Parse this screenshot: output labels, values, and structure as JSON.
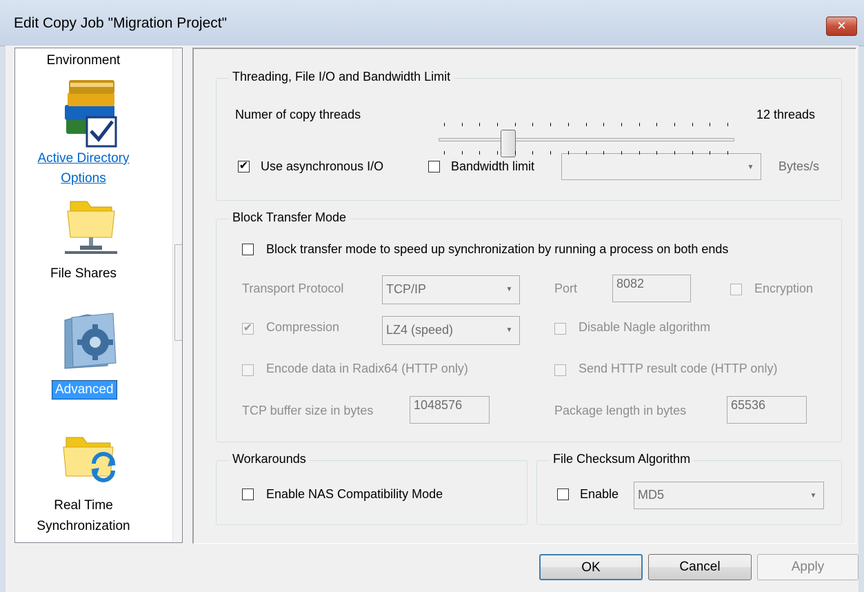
{
  "window": {
    "title": "Edit Copy Job \"Migration Project\"",
    "close_label": "✕"
  },
  "sidebar": {
    "items": [
      {
        "label": "Environment",
        "icon": "books-check-icon"
      },
      {
        "label": "Active Directory Options",
        "icon": "books-check-icon",
        "link": true
      },
      {
        "label": "File Shares",
        "icon": "network-folder-icon"
      },
      {
        "label": "Advanced",
        "icon": "gear-folder-icon",
        "selected": true
      },
      {
        "label": "Real Time Synchronization",
        "icon": "sync-folder-icon"
      }
    ],
    "scroll_up": "▲",
    "scroll_down": "▼"
  },
  "threading": {
    "legend": "Threading, File I/O and Bandwidth Limit",
    "threads_label": "Numer of copy threads",
    "threads_value": "12 threads",
    "threads_fraction": 0.25,
    "async_label": "Use asynchronous I/O",
    "async_checked": true,
    "bandwidth_label": "Bandwidth limit",
    "bandwidth_checked": false,
    "bandwidth_value": "",
    "bandwidth_unit": "Bytes/s"
  },
  "block": {
    "legend": "Block Transfer Mode",
    "enable_label": "Block transfer mode to speed up synchronization by running a process on both ends",
    "transport_label": "Transport Protocol",
    "transport_value": "TCP/IP",
    "port_label": "Port",
    "port_value": "8082",
    "encryption_label": "Encryption",
    "compression_label": "Compression",
    "compression_value": "LZ4 (speed)",
    "nagle_label": "Disable Nagle algorithm",
    "radix_label": "Encode data in Radix64 (HTTP only)",
    "http_label": "Send HTTP result code (HTTP only)",
    "tcp_buffer_label": "TCP buffer size in bytes",
    "tcp_buffer_value": "1048576",
    "package_label": "Package length in bytes",
    "package_value": "65536"
  },
  "workarounds": {
    "legend": "Workarounds",
    "nas_label": "Enable NAS Compatibility Mode"
  },
  "checksum": {
    "legend": "File Checksum Algorithm",
    "enable_label": "Enable",
    "algorithm_value": "MD5"
  },
  "buttons": {
    "ok": "OK",
    "cancel": "Cancel",
    "apply": "Apply"
  }
}
